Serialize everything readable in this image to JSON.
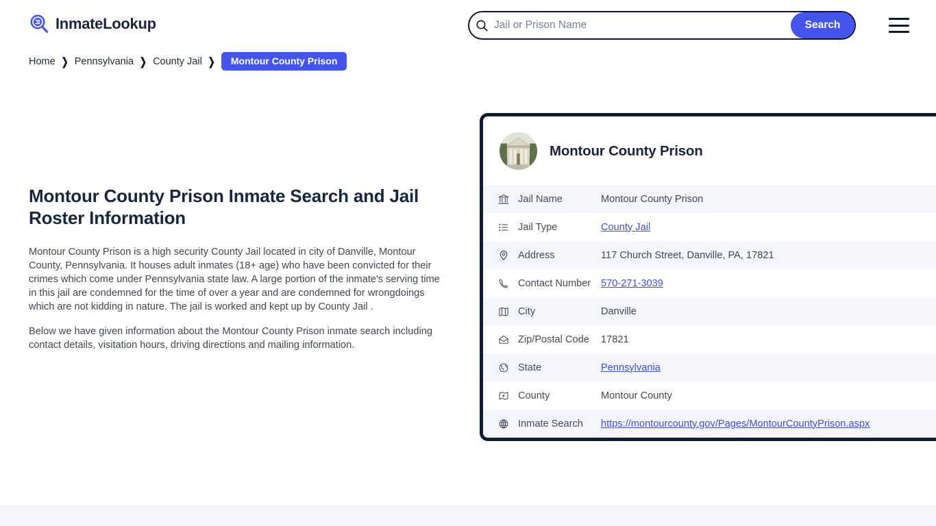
{
  "header": {
    "brand_name": "InmateLookup",
    "brand_icon": "search-logo-icon",
    "search": {
      "placeholder": "Jail or Prison Name",
      "value": "",
      "icon": "search-icon",
      "button_label": "Search"
    },
    "menu_icon": "hamburger-menu-icon"
  },
  "breadcrumb": {
    "items": [
      {
        "label": "Home",
        "active": false
      },
      {
        "label": "Pennsylvania",
        "active": false
      },
      {
        "label": "County Jail",
        "active": false
      },
      {
        "label": "Montour County Prison",
        "active": true
      }
    ],
    "separator": "❯"
  },
  "main": {
    "title": "Montour County Prison Inmate Search and Jail Roster Information",
    "paragraphs": [
      "Montour County Prison is a high security County Jail located in city of Danville, Montour County, Pennsylvania. It houses adult inmates (18+ age) who have been convicted for their crimes which come under Pennsylvania state law. A large portion of the inmate's serving time in this jail are condemned for the time of over a year and are condemned for wrongdoings which are not kidding in nature. The jail is worked and kept up by County Jail .",
      "Below we have given information about the Montour County Prison inmate search including contact details, visitation hours, driving directions and mailing information."
    ]
  },
  "card": {
    "avatar_icon": "courthouse-photo",
    "title": "Montour County Prison",
    "rows": [
      {
        "icon": "landmark-icon",
        "label": "Jail Name",
        "value": "Montour County Prison",
        "is_link": false
      },
      {
        "icon": "list-icon",
        "label": "Jail Type",
        "value": "County Jail",
        "is_link": true
      },
      {
        "icon": "map-pin-icon",
        "label": "Address",
        "value": "117 Church Street, Danville, PA, 17821",
        "is_link": false
      },
      {
        "icon": "phone-icon",
        "label": "Contact Number",
        "value": "570-271-3039",
        "is_link": true
      },
      {
        "icon": "map-icon",
        "label": "City",
        "value": "Danville",
        "is_link": false
      },
      {
        "icon": "envelope-icon",
        "label": "Zip/Postal Code",
        "value": "17821",
        "is_link": false
      },
      {
        "icon": "globe-icon",
        "label": "State",
        "value": "Pennsylvania",
        "is_link": true
      },
      {
        "icon": "map-marked-icon",
        "label": "County",
        "value": "Montour County",
        "is_link": false
      },
      {
        "icon": "web-globe-icon",
        "label": "Inmate Search",
        "value": "https://montourcounty.gov/Pages/MontourCountyPrison.aspx",
        "is_link": true
      }
    ]
  },
  "colors": {
    "accent": "#4354f0",
    "link": "#3b4fd8",
    "card_border": "#101a33",
    "row_alt_bg": "#f5f5fc",
    "band_bg": "#f5f5fd",
    "text_dark": "#1b2440"
  }
}
